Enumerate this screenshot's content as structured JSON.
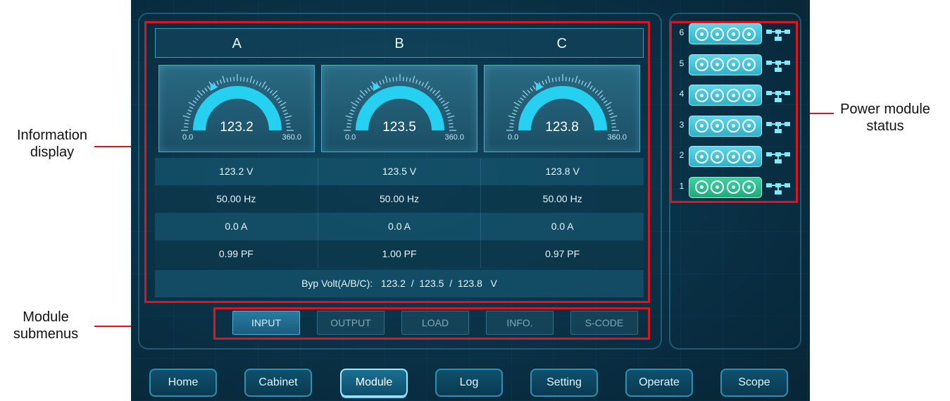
{
  "annotations": {
    "info_display": [
      "Information",
      "display"
    ],
    "module_submenus": [
      "Module",
      "submenus"
    ],
    "power_module_status": [
      "Power module",
      "status"
    ]
  },
  "phases": [
    "A",
    "B",
    "C"
  ],
  "gauges": [
    {
      "value": "123.2",
      "min": "0.0",
      "max": "360.0"
    },
    {
      "value": "123.5",
      "min": "0.0",
      "max": "360.0"
    },
    {
      "value": "123.8",
      "min": "0.0",
      "max": "360.0"
    }
  ],
  "table": {
    "rows": [
      [
        "123.2  V",
        "123.5  V",
        "123.8  V"
      ],
      [
        "50.00 Hz",
        "50.00 Hz",
        "50.00 Hz"
      ],
      [
        "0.0   A",
        "0.0   A",
        "0.0   A"
      ],
      [
        "0.99 PF",
        "1.00 PF",
        "0.97 PF"
      ]
    ],
    "bypass": "Byp Volt(A/B/C):   123.2  /  123.5  /  123.8   V"
  },
  "submenus": [
    "INPUT",
    "OUTPUT",
    "LOAD",
    "INFO.",
    "S-CODE"
  ],
  "modules": [
    {
      "num": "6",
      "state": "normal"
    },
    {
      "num": "5",
      "state": "normal"
    },
    {
      "num": "4",
      "state": "normal"
    },
    {
      "num": "3",
      "state": "normal"
    },
    {
      "num": "2",
      "state": "normal"
    },
    {
      "num": "1",
      "state": "online"
    }
  ],
  "nav": [
    "Home",
    "Cabinet",
    "Module",
    "Log",
    "Setting",
    "Operate",
    "Scope"
  ],
  "colors": {
    "highlight": "#e0141e",
    "gauge_arc": "#26d0f0",
    "module_normal": "#3fc4da",
    "module_online": "#2ebf8f"
  }
}
